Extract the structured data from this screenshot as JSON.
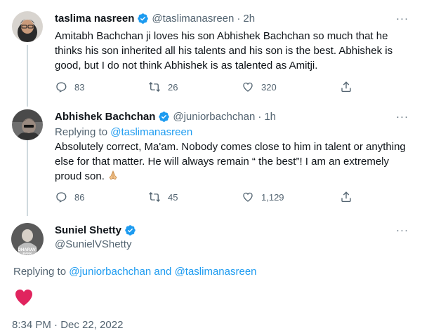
{
  "tweets": [
    {
      "name": "taslima nasreen",
      "handle": "@taslimanasreen",
      "dot": "·",
      "time": "2h",
      "text": "Amitabh Bachchan ji loves his son Abhishek Bachchan so much that he thinks his son inherited all his talents and his son is the best.  Abhishek is good, but I do not think Abhishek is as talented as Amitji.",
      "replies": "83",
      "retweets": "26",
      "likes": "320"
    },
    {
      "name": "Abhishek Bachchan",
      "handle": "@juniorbachchan",
      "dot": "·",
      "time": "1h",
      "replying_prefix": "Replying to ",
      "replying_to": "@taslimanasreen",
      "text": "Absolutely correct, Ma'am. Nobody comes close to him in talent or anything else for that matter. He will always remain “ the best”! I am an extremely proud son.",
      "replies": "86",
      "retweets": "45",
      "likes": "1,129"
    },
    {
      "name": "Suniel Shetty",
      "handle": "@SunielVShetty",
      "avatar_text": "DHARAVI BANK",
      "replying_prefix": "Replying to ",
      "replying_to_1": "@juniorbachchan",
      "replying_and": " and ",
      "replying_to_2": "@taslimanasreen",
      "timestamp": "8:34 PM · Dec 22, 2022"
    }
  ],
  "more_label": "···",
  "colors": {
    "accent": "#1d9bf0",
    "muted": "#536471",
    "heart": "#e0245e",
    "verified": "#1d9bf0"
  },
  "icons": [
    "verified-badge-icon",
    "more-icon",
    "reply-icon",
    "retweet-icon",
    "like-icon",
    "share-icon",
    "folded-hands-icon",
    "heart-icon"
  ]
}
